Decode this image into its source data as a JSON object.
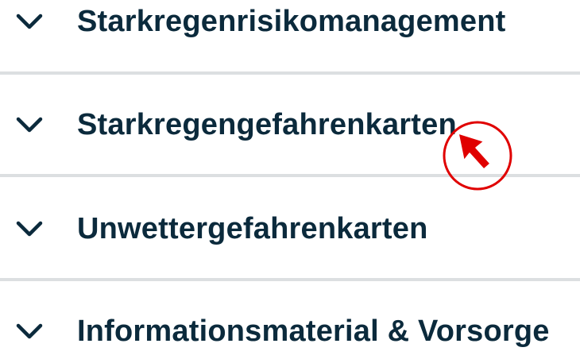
{
  "accordion": {
    "items": [
      {
        "label": "Starkregenrisikomanagement",
        "icon": "chevron-down-icon"
      },
      {
        "label": "Starkregengefahrenkarten",
        "icon": "chevron-down-icon"
      },
      {
        "label": "Unwettergefahrenkarten",
        "icon": "chevron-down-icon"
      },
      {
        "label": "Informationsmaterial & Vorsorge",
        "icon": "chevron-down-icon"
      }
    ]
  },
  "colors": {
    "text": "#0b2a3c",
    "divider": "#dcdfe1",
    "cursor_highlight": "#e00000"
  },
  "pointer": {
    "icon": "mouse-pointer-icon"
  }
}
